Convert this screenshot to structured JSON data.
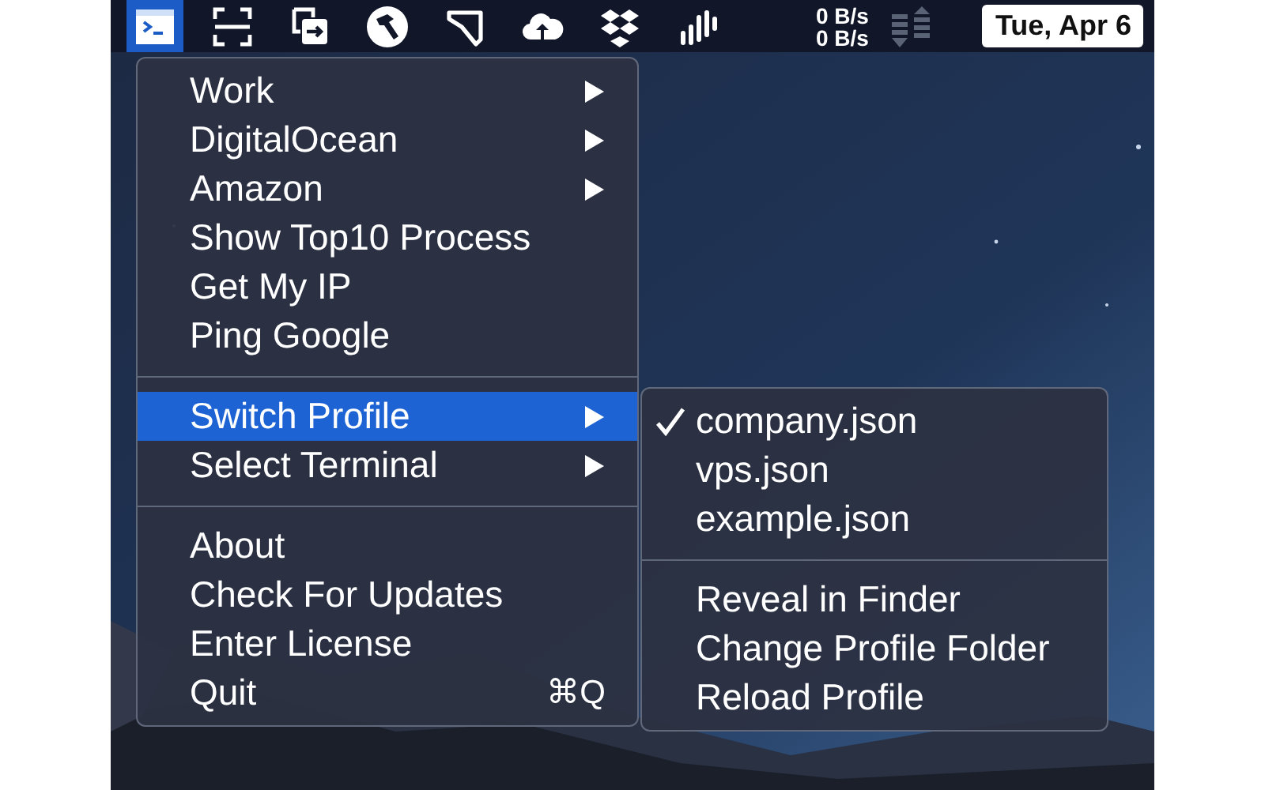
{
  "menu_bar": {
    "icons": [
      {
        "kind": "terminal",
        "selected": true
      },
      {
        "kind": "capture",
        "selected": false
      },
      {
        "kind": "transfer",
        "selected": false
      },
      {
        "kind": "hammer",
        "selected": false
      },
      {
        "kind": "shape",
        "selected": false
      },
      {
        "kind": "cloud",
        "selected": false
      },
      {
        "kind": "boxes",
        "selected": false
      },
      {
        "kind": "bars",
        "selected": false
      }
    ],
    "network": {
      "upload": "0 B/s",
      "download": "0 B/s"
    },
    "clock": "Tue, Apr 6"
  },
  "menu": {
    "items": [
      {
        "kind": "item",
        "label": "Work",
        "has_submenu": true,
        "selected": false
      },
      {
        "kind": "item",
        "label": "DigitalOcean",
        "has_submenu": true,
        "selected": false
      },
      {
        "kind": "item",
        "label": "Amazon",
        "has_submenu": true,
        "selected": false
      },
      {
        "kind": "item",
        "label": "Show Top10 Process",
        "has_submenu": false,
        "selected": false
      },
      {
        "kind": "item",
        "label": "Get My IP",
        "has_submenu": false,
        "selected": false
      },
      {
        "kind": "item",
        "label": "Ping Google",
        "has_submenu": false,
        "selected": false
      },
      {
        "kind": "separator"
      },
      {
        "kind": "item",
        "label": "Switch Profile",
        "has_submenu": true,
        "selected": true
      },
      {
        "kind": "item",
        "label": "Select Terminal",
        "has_submenu": true,
        "selected": false
      },
      {
        "kind": "separator"
      },
      {
        "kind": "item",
        "label": "About",
        "has_submenu": false,
        "selected": false
      },
      {
        "kind": "item",
        "label": "Check For Updates",
        "has_submenu": false,
        "selected": false
      },
      {
        "kind": "item",
        "label": "Enter License",
        "has_submenu": false,
        "selected": false
      },
      {
        "kind": "item",
        "label": "Quit",
        "has_submenu": false,
        "selected": false,
        "shortcut": "⌘Q"
      }
    ]
  },
  "submenu": {
    "items": [
      {
        "kind": "item",
        "label": "company.json",
        "checked": true
      },
      {
        "kind": "item",
        "label": "vps.json",
        "checked": false
      },
      {
        "kind": "item",
        "label": "example.json",
        "checked": false
      },
      {
        "kind": "separator"
      },
      {
        "kind": "item",
        "label": "Reveal in Finder",
        "checked": false
      },
      {
        "kind": "item",
        "label": "Change Profile Folder",
        "checked": false
      },
      {
        "kind": "item",
        "label": "Reload Profile",
        "checked": false
      }
    ]
  }
}
